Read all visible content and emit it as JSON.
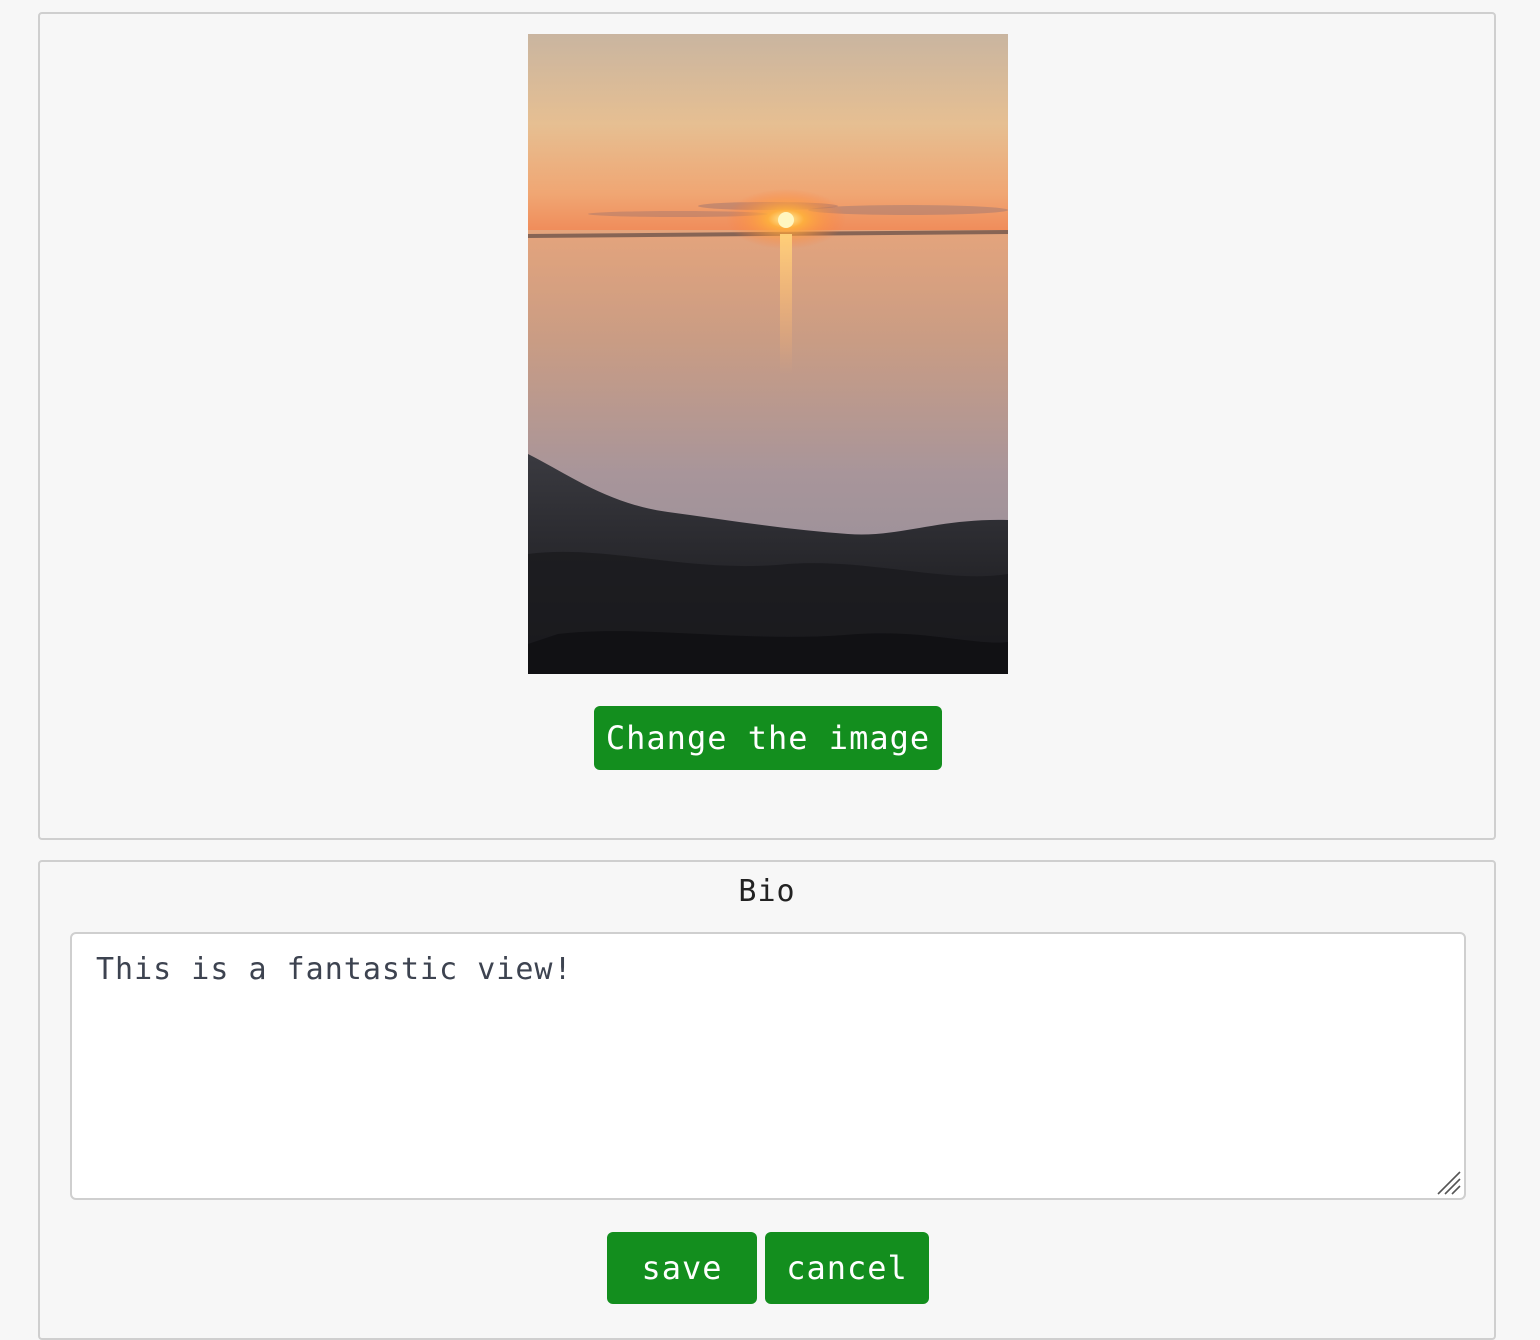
{
  "image_panel": {
    "change_button_label": "Change the image"
  },
  "bio_panel": {
    "title": "Bio",
    "bio_text": "This is a fantastic view!",
    "save_label": "save",
    "cancel_label": "cancel"
  },
  "colors": {
    "button_green": "#138e1e",
    "panel_background": "#f7f7f7",
    "panel_border": "#cfcfcf"
  }
}
